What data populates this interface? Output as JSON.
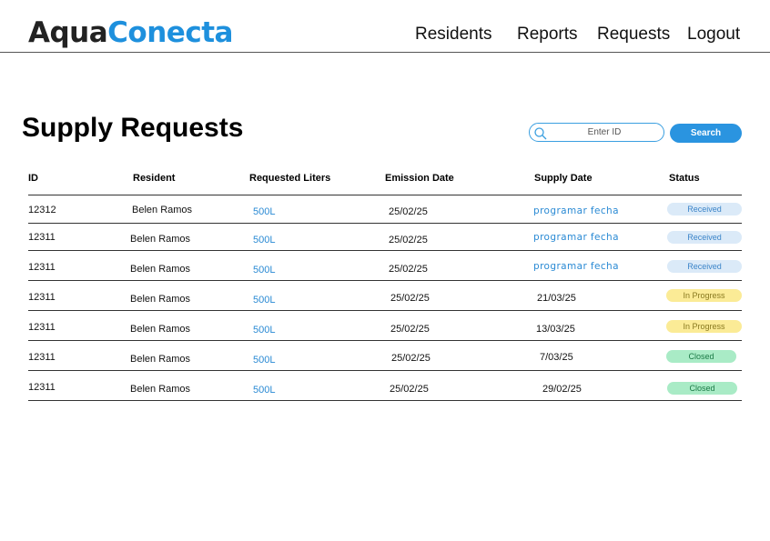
{
  "app": {
    "logo_part1": "Aqua",
    "logo_part2": "Conecta"
  },
  "nav": {
    "residents": "Residents",
    "reports": "Reports",
    "requests": "Requests",
    "logout": "Logout"
  },
  "page": {
    "title": "Supply Requests"
  },
  "search": {
    "placeholder": "Enter ID",
    "button_label": "Search"
  },
  "table": {
    "headers": {
      "id": "ID",
      "resident": "Resident",
      "liters": "Requested Liters",
      "emission": "Emission Date",
      "supply": "Supply Date",
      "status": "Status"
    },
    "rows": [
      {
        "id": "12312",
        "resident": "Belen Ramos",
        "liters": "500L",
        "emission": "25/02/25",
        "supply": "programar fecha",
        "status": "Received"
      },
      {
        "id": "12311",
        "resident": "Belen Ramos",
        "liters": "500L",
        "emission": "25/02/25",
        "supply": "programar fecha",
        "status": "Received"
      },
      {
        "id": "12311",
        "resident": "Belen Ramos",
        "liters": "500L",
        "emission": "25/02/25",
        "supply": "programar fecha",
        "status": "Received"
      },
      {
        "id": "12311",
        "resident": "Belen Ramos",
        "liters": "500L",
        "emission": "25/02/25",
        "supply": "21/03/25",
        "status": "In Progress"
      },
      {
        "id": "12311",
        "resident": "Belen Ramos",
        "liters": "500L",
        "emission": "25/02/25",
        "supply": "13/03/25",
        "status": "In Progress"
      },
      {
        "id": "12311",
        "resident": "Belen Ramos",
        "liters": "500L",
        "emission": "25/02/25",
        "supply": "7/03/25",
        "status": "Closed"
      },
      {
        "id": "12311",
        "resident": "Belen Ramos",
        "liters": "500L",
        "emission": "25/02/25",
        "supply": "29/02/25",
        "status": "Closed"
      }
    ]
  },
  "colors": {
    "brand": "#1e90dd",
    "received": "#dbeaf8",
    "in_progress": "#fbeb96",
    "closed": "#a9ebc6"
  }
}
